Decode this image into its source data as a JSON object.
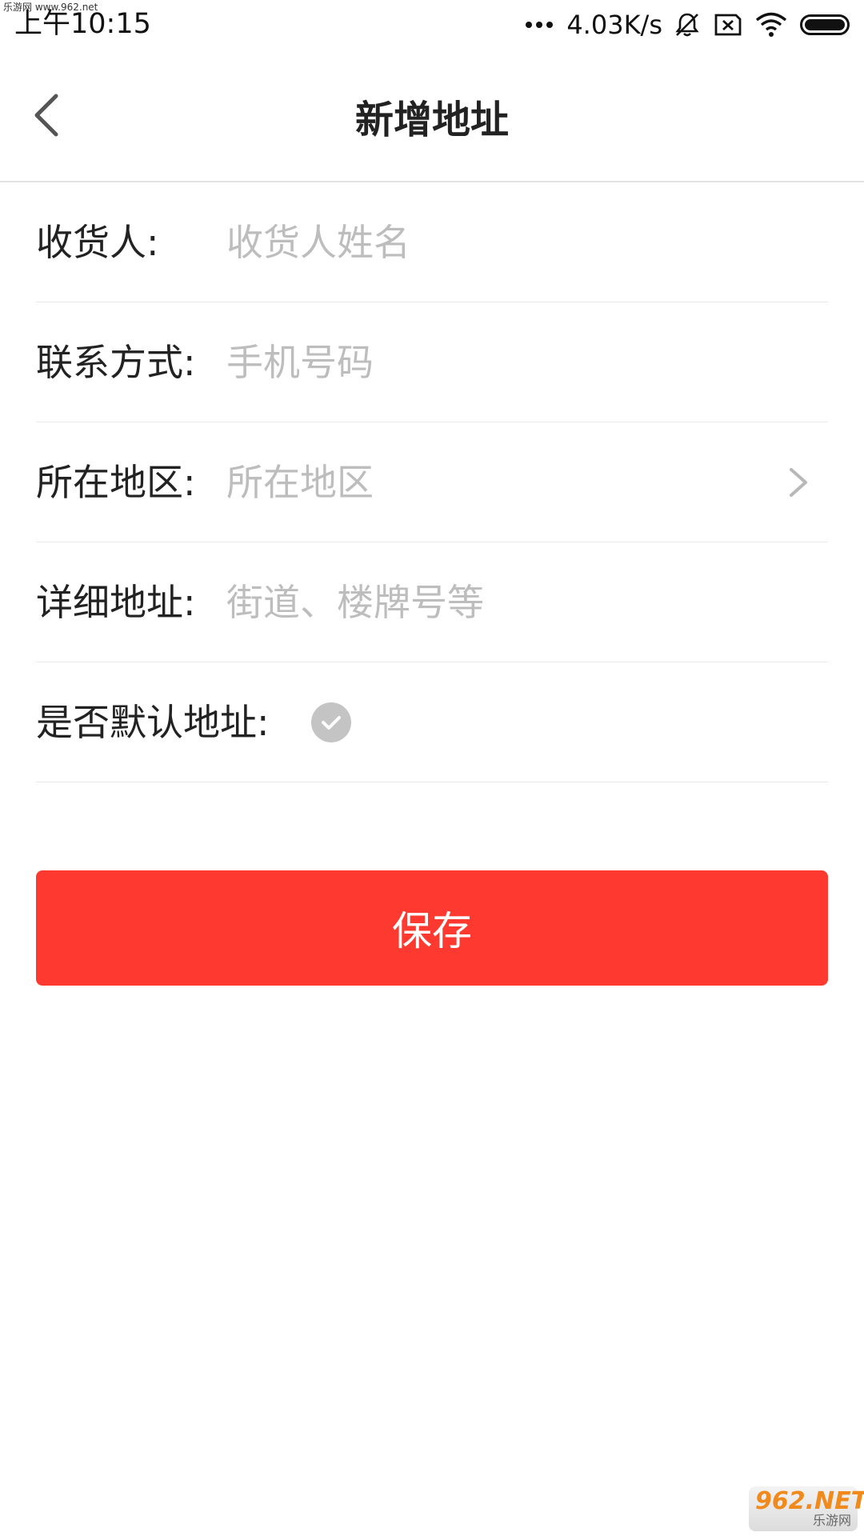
{
  "watermark_top": "乐游网 www.962.net",
  "status_bar": {
    "time": "上午10:15",
    "net_speed": "4.03K/s",
    "icons": [
      "more-dots-icon",
      "mute-bell-icon",
      "sim-off-icon",
      "wifi-icon",
      "battery-icon"
    ]
  },
  "header": {
    "title": "新增地址",
    "back_icon": "chevron-left-icon"
  },
  "form": {
    "receiver": {
      "label": "收货人:",
      "placeholder": "收货人姓名",
      "value": ""
    },
    "phone": {
      "label": "联系方式:",
      "placeholder": "手机号码",
      "value": ""
    },
    "region": {
      "label": "所在地区:",
      "placeholder": "所在地区",
      "icon": "chevron-right-icon"
    },
    "detail": {
      "label": "详细地址:",
      "placeholder": "街道、楼牌号等",
      "value": ""
    },
    "default_address": {
      "label": "是否默认地址:",
      "checked": false,
      "icon": "check-circle-icon"
    }
  },
  "save_button": {
    "label": "保存",
    "color": "#fe3a30"
  },
  "watermark_bottom": {
    "logo": "962.NET",
    "sub": "乐游网"
  }
}
